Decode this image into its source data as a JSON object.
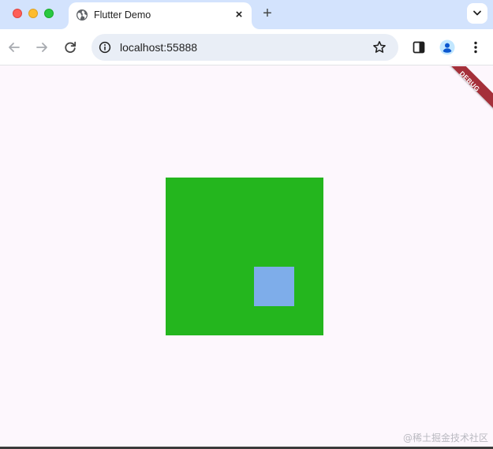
{
  "browser": {
    "tab": {
      "title": "Flutter Demo",
      "close_glyph": "×"
    },
    "new_tab_glyph": "+",
    "address_bar": {
      "url": "localhost:55888"
    },
    "icons": {
      "favicon": "globe-icon",
      "back": "arrow-left-icon",
      "forward": "arrow-right-icon",
      "reload": "reload-icon",
      "info": "info-icon",
      "bookmark": "star-icon",
      "side_panel": "side-panel-icon",
      "profile": "profile-icon",
      "menu": "kebab-menu-icon",
      "tab_search": "chevron-down-icon"
    }
  },
  "app": {
    "debug_banner": "DEBUG",
    "outer_box_color": "#24b61e",
    "inner_box_color": "#7eadea",
    "background_color": "#fdf7fd"
  },
  "watermark": "@稀土掘金技术社区"
}
